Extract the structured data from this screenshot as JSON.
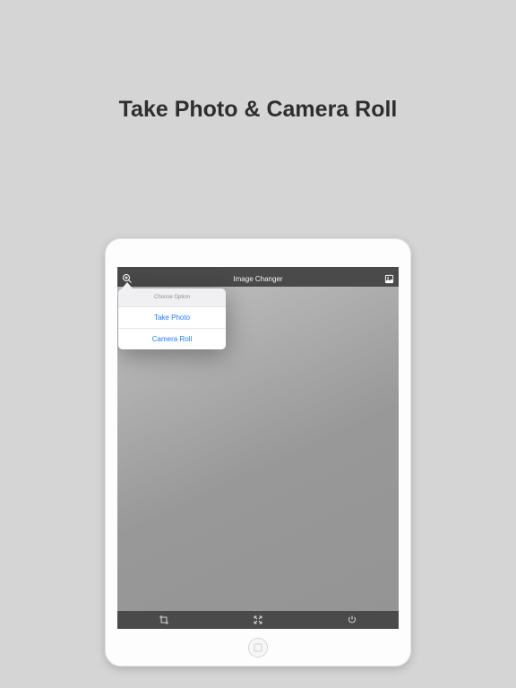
{
  "headline": "Take Photo & Camera Roll",
  "header": {
    "title": "Image Changer"
  },
  "popover": {
    "label": "Choose Option",
    "items": [
      {
        "label": "Take Photo"
      },
      {
        "label": "Camera Roll"
      }
    ]
  }
}
